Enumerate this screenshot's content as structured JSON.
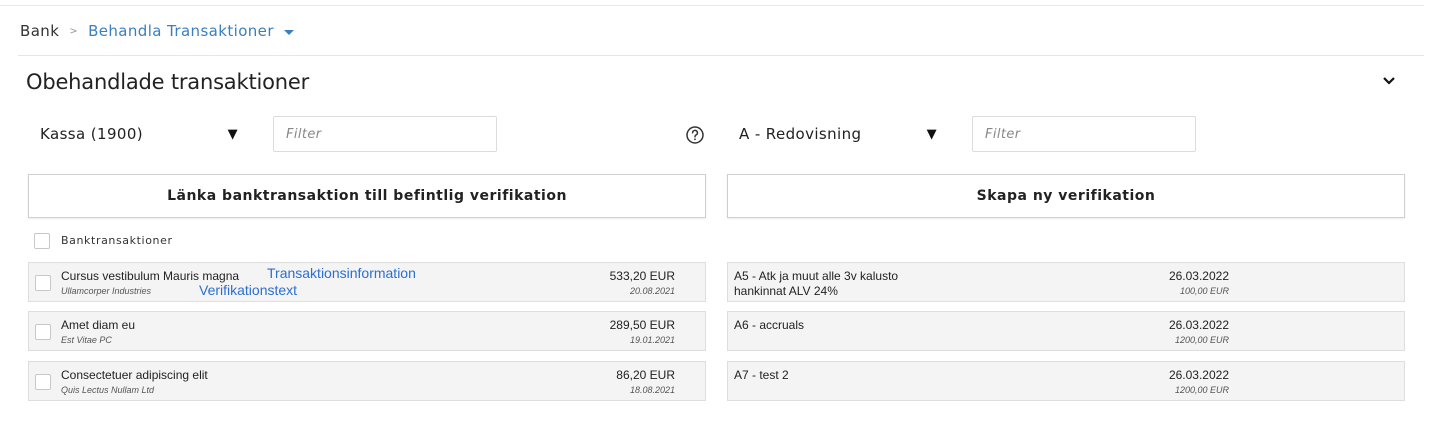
{
  "breadcrumb": {
    "root": "Bank",
    "separator": ">",
    "current": "Behandla Transaktioner"
  },
  "section": {
    "title": "Obehandlade transaktioner"
  },
  "left_controls": {
    "account_select": "Kassa (1900)",
    "filter_placeholder": "Filter"
  },
  "right_controls": {
    "series_select": "A - Redovisning",
    "filter_placeholder": "Filter"
  },
  "dropdown_arrow": "▼",
  "buttons": {
    "link": "Länka banktransaktion till befintlig verifikation",
    "create": "Skapa ny verifikation"
  },
  "bank_list": {
    "header_label": "Banktransaktioner",
    "rows": [
      {
        "title": "Cursus vestibulum Mauris magna",
        "sub": "Ullamcorper Industries",
        "amount": "533,20 EUR",
        "date": "20.08.2021"
      },
      {
        "title": "Amet diam eu",
        "sub": "Est Vitae PC",
        "amount": "289,50 EUR",
        "date": "19.01.2021"
      },
      {
        "title": "Consectetuer adipiscing elit",
        "sub": "Quis Lectus Nullam Ltd",
        "amount": "86,20 EUR",
        "date": "18.08.2021"
      }
    ]
  },
  "verification_list": {
    "rows": [
      {
        "title": "A5 - Atk ja muut alle 3v kalusto",
        "title2": "hankinnat ALV 24%",
        "date": "26.03.2022",
        "amount": "100,00 EUR"
      },
      {
        "title": "A6 - accruals",
        "title2": "",
        "date": "26.03.2022",
        "amount": "1200,00 EUR"
      },
      {
        "title": "A7 - test 2",
        "title2": "",
        "date": "26.03.2022",
        "amount": "1200,00 EUR"
      }
    ]
  },
  "annotations": {
    "transaction_info": "Transaktionsinformation",
    "verification_text": "Verifikationstext"
  },
  "icons": {
    "collapse": "chevron-down-icon",
    "help": "question-circle-icon",
    "caret": "caret-down-icon"
  },
  "colors": {
    "link_blue": "#3a7fc1",
    "annotation_blue": "#2b6fd0"
  }
}
